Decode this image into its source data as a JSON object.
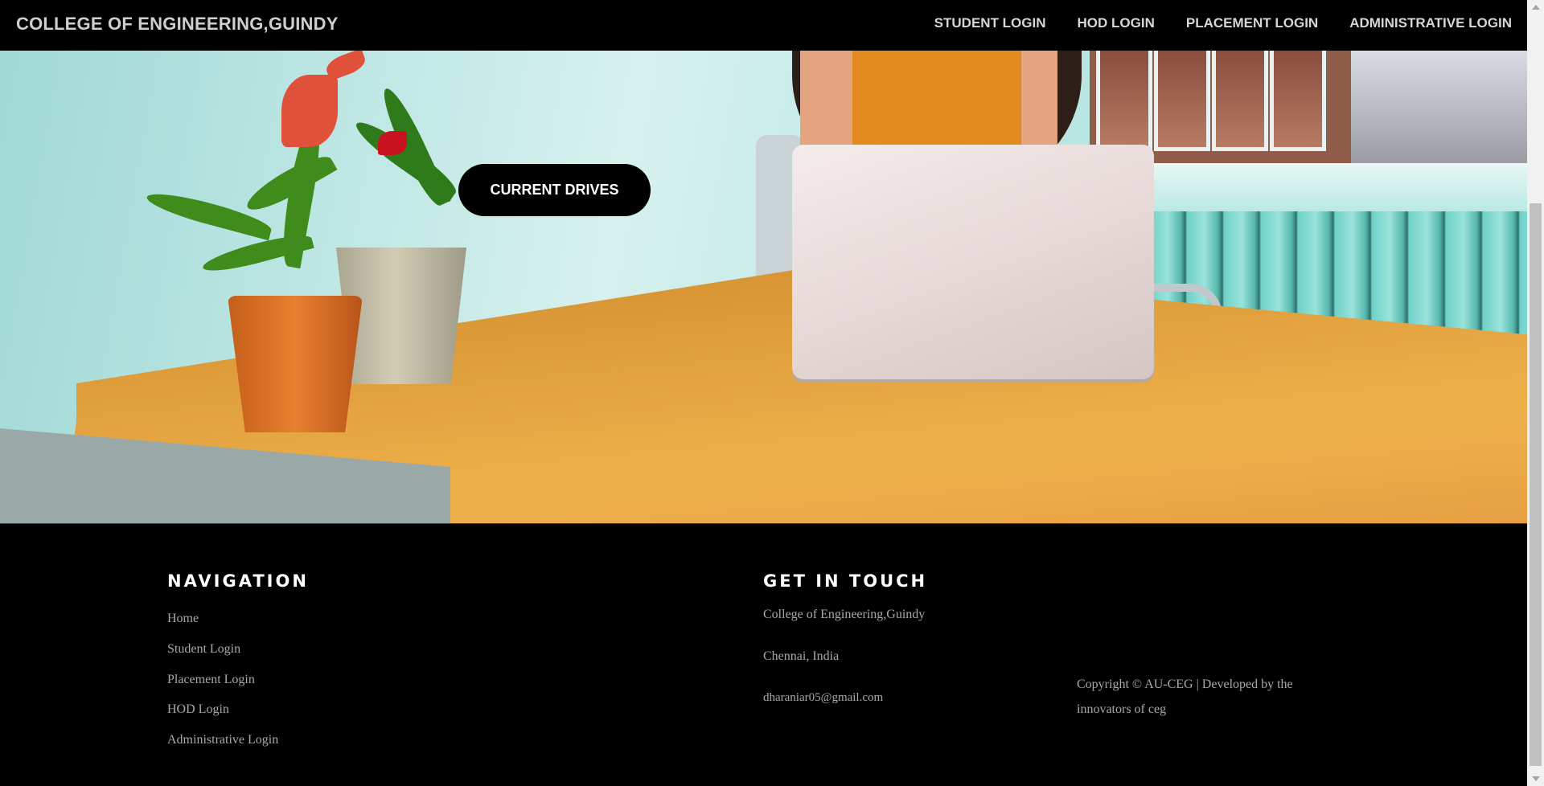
{
  "header": {
    "title": "COLLEGE OF ENGINEERING,GUINDY",
    "nav": [
      "STUDENT LOGIN",
      "HOD LOGIN",
      "PLACEMENT LOGIN",
      "ADMINISTRATIVE LOGIN"
    ]
  },
  "hero": {
    "button_label": "CURRENT DRIVES"
  },
  "footer": {
    "navigation": {
      "heading": "NAVIGATION",
      "links": [
        "Home",
        "Student Login",
        "Placement Login",
        "HOD Login",
        "Administrative Login"
      ]
    },
    "contact": {
      "heading": "GET IN TOUCH",
      "college": "College of Engineering,Guindy",
      "location": "Chennai, India",
      "email": "dharaniar05@gmail.com"
    },
    "copyright": "Copyright © AU-CEG | Developed by the innovators of ceg"
  },
  "colors": {
    "header_bg": "#000000",
    "footer_bg": "#000000",
    "button_bg": "#000000",
    "text_light": "#d6d6d6",
    "footer_text": "#a8a8a8"
  }
}
